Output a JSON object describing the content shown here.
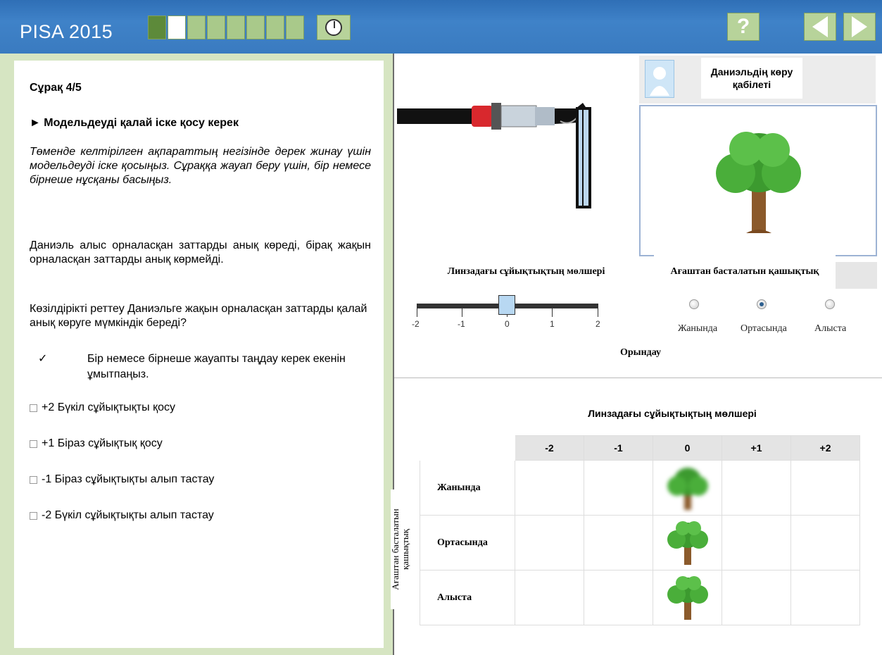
{
  "header": {
    "app_title": "PISA 2015",
    "progress": {
      "total": 8,
      "done": 1,
      "current": 2
    },
    "timer_icon": "clock-icon",
    "help_label": "?",
    "nav": {
      "prev_icon": "arrow-left-icon",
      "next_icon": "arrow-right-icon"
    },
    "colors": {
      "bar": "#3f82c8",
      "button": "#b7d39a",
      "done_segment": "#5d8a3a"
    }
  },
  "question": {
    "number": "Сұрақ 4/5",
    "title": "► Модельдеуді қалай іске қосу керек",
    "intro": "Төменде келтірілген ақпараттың негізінде дерек жинау үшін модельдеуді іске қосыңыз. Сұраққа жауап беру үшін, бір немесе бірнеше нұсқаны басыңыз.",
    "para1": "Даниэль алыс орналасқан заттарды анық көреді, бірақ жақын орналасқан заттарды анық көрмейді.",
    "para2": "Көзілдірікті реттеу Даниэльге жақын орналасқан заттарды қалай анық көруге мүмкіндік береді?",
    "hint_mark": "✓",
    "hint": "Бір немесе бірнеше жауапты таңдау керек екенін ұмытпаңыз.",
    "options": [
      {
        "label": "+2 Бүкіл сұйықтықты қосу",
        "checked": false
      },
      {
        "label": "+1 Біраз сұйықтық қосу",
        "checked": false
      },
      {
        "label": "-1 Біраз сұйықтықты алып тастау",
        "checked": false
      },
      {
        "label": "-2 Бүкіл сұйықтықты алып тастау",
        "checked": false
      }
    ]
  },
  "simulation": {
    "vision_title": "Даниэльдің көру қабілеті",
    "lens_label": "Линзадағы сұйықтықтың мөлшері",
    "slider": {
      "ticks": [
        "-2",
        "-1",
        "0",
        "1",
        "2"
      ],
      "value": 0
    },
    "distance_label": "Ағаштан басталатын қашықтық",
    "distance_options": [
      "Жанында",
      "Ортасында",
      "Алыста"
    ],
    "distance_selected": "Ортасында",
    "run_label": "Орындау"
  },
  "results": {
    "title": "Линзадағы сұйықтықтың мөлшері",
    "row_axis_label": "Ағаштан басталатын қашықтық",
    "columns": [
      "-2",
      "-1",
      "0",
      "+1",
      "+2"
    ],
    "rows": [
      {
        "label": "Жанында",
        "cells": [
          "",
          "",
          "blurry-tree",
          "",
          ""
        ]
      },
      {
        "label": "Ортасында",
        "cells": [
          "",
          "",
          "clear-tree",
          "",
          ""
        ]
      },
      {
        "label": "Алыста",
        "cells": [
          "",
          "",
          "clear-tree",
          "",
          ""
        ]
      }
    ]
  }
}
